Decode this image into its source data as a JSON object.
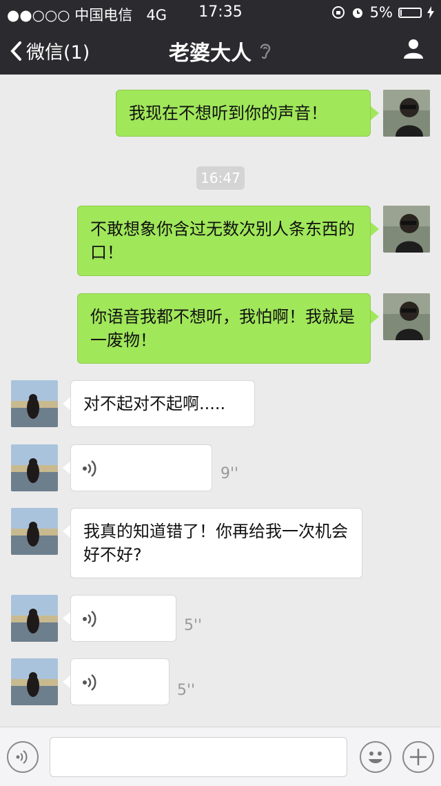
{
  "status_bar": {
    "carrier": "●●○○○ 中国电信",
    "network": "4G",
    "time": "17:35",
    "battery": "5%",
    "battery_level": 0.05
  },
  "nav": {
    "back_label": "微信(1)",
    "title": "老婆大人"
  },
  "timestamp": "16:47",
  "messages": [
    {
      "from": "me",
      "type": "text",
      "text": "我现在不想听到你的声音！"
    },
    {
      "from": "me",
      "type": "text",
      "text": "不敢想象你含过无数次别人条东西的口！"
    },
    {
      "from": "me",
      "type": "text",
      "text": "你语音我都不想听，我怕啊！我就是一废物！"
    },
    {
      "from": "her",
      "type": "text",
      "text": "对不起对不起啊....."
    },
    {
      "from": "her",
      "type": "voice",
      "duration": "9''"
    },
    {
      "from": "her",
      "type": "text",
      "text": "我真的知道错了！你再给我一次机会好不好?"
    },
    {
      "from": "her",
      "type": "voice",
      "duration": "5''"
    },
    {
      "from": "her",
      "type": "voice",
      "duration": "5''"
    }
  ],
  "colors": {
    "nav_bg": "#2b2b2f",
    "sent_bubble": "#a0e75a",
    "chat_bg": "#ebebeb"
  },
  "icons": [
    "back-chevron-icon",
    "ear-icon",
    "person-icon",
    "voice-wave-icon",
    "emoji-icon",
    "plus-icon"
  ]
}
